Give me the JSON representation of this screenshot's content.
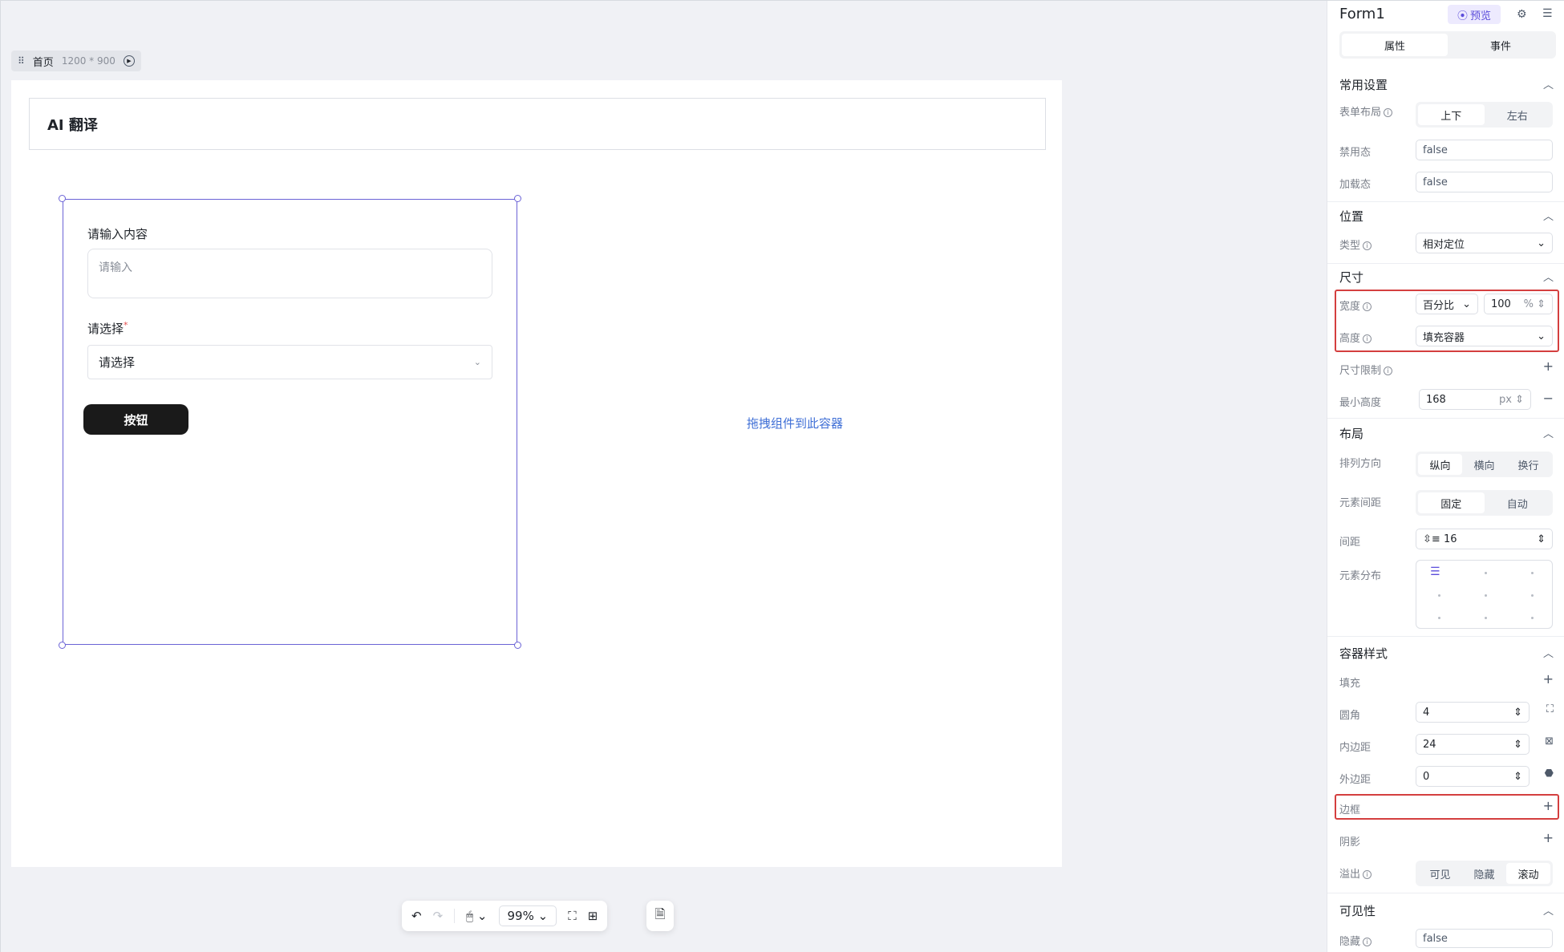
{
  "canvas": {
    "page_name": "首页",
    "page_size": "1200 * 900",
    "header_title": "AI 翻译",
    "form": {
      "field1_label": "请输入内容",
      "field1_placeholder": "请输入",
      "field2_label": "请选择",
      "field2_required": "*",
      "select_placeholder": "请选择",
      "button_label": "按钮"
    },
    "drop_hint": "拖拽组件到此容器"
  },
  "toolbar": {
    "zoom": "99%"
  },
  "panel": {
    "title": "Form1",
    "preview": "预览",
    "tabs": [
      "属性",
      "事件"
    ],
    "common": {
      "title": "常用设置",
      "layout_label": "表单布局",
      "layout_options": [
        "上下",
        "左右"
      ],
      "disabled_label": "禁用态",
      "disabled_value": "false",
      "loading_label": "加载态",
      "loading_value": "false"
    },
    "position": {
      "title": "位置",
      "type_label": "类型",
      "type_value": "相对定位"
    },
    "size": {
      "title": "尺寸",
      "width_label": "宽度",
      "width_mode": "百分比",
      "width_value": "100",
      "width_unit": "%",
      "height_label": "高度",
      "height_value": "填充容器",
      "limit_label": "尺寸限制",
      "min_height_label": "最小高度",
      "min_height_value": "168",
      "min_height_unit": "px"
    },
    "layout": {
      "title": "布局",
      "direction_label": "排列方向",
      "direction_options": [
        "纵向",
        "横向",
        "换行"
      ],
      "spacing_mode_label": "元素间距",
      "spacing_mode_options": [
        "固定",
        "自动"
      ],
      "gap_label": "间距",
      "gap_value": "16",
      "distribution_label": "元素分布"
    },
    "style": {
      "title": "容器样式",
      "fill_label": "填充",
      "radius_label": "圆角",
      "radius_value": "4",
      "padding_label": "内边距",
      "padding_value": "24",
      "margin_label": "外边距",
      "margin_value": "0",
      "border_label": "边框",
      "shadow_label": "阴影",
      "overflow_label": "溢出",
      "overflow_options": [
        "可见",
        "隐藏",
        "滚动"
      ]
    },
    "visibility": {
      "title": "可见性",
      "hidden_label": "隐藏",
      "hidden_value": "false"
    }
  },
  "colors": {
    "accent": "#5b4ddb",
    "selection": "#6b63d6",
    "highlight": "#d43f3f",
    "link": "#3f6fd6"
  }
}
